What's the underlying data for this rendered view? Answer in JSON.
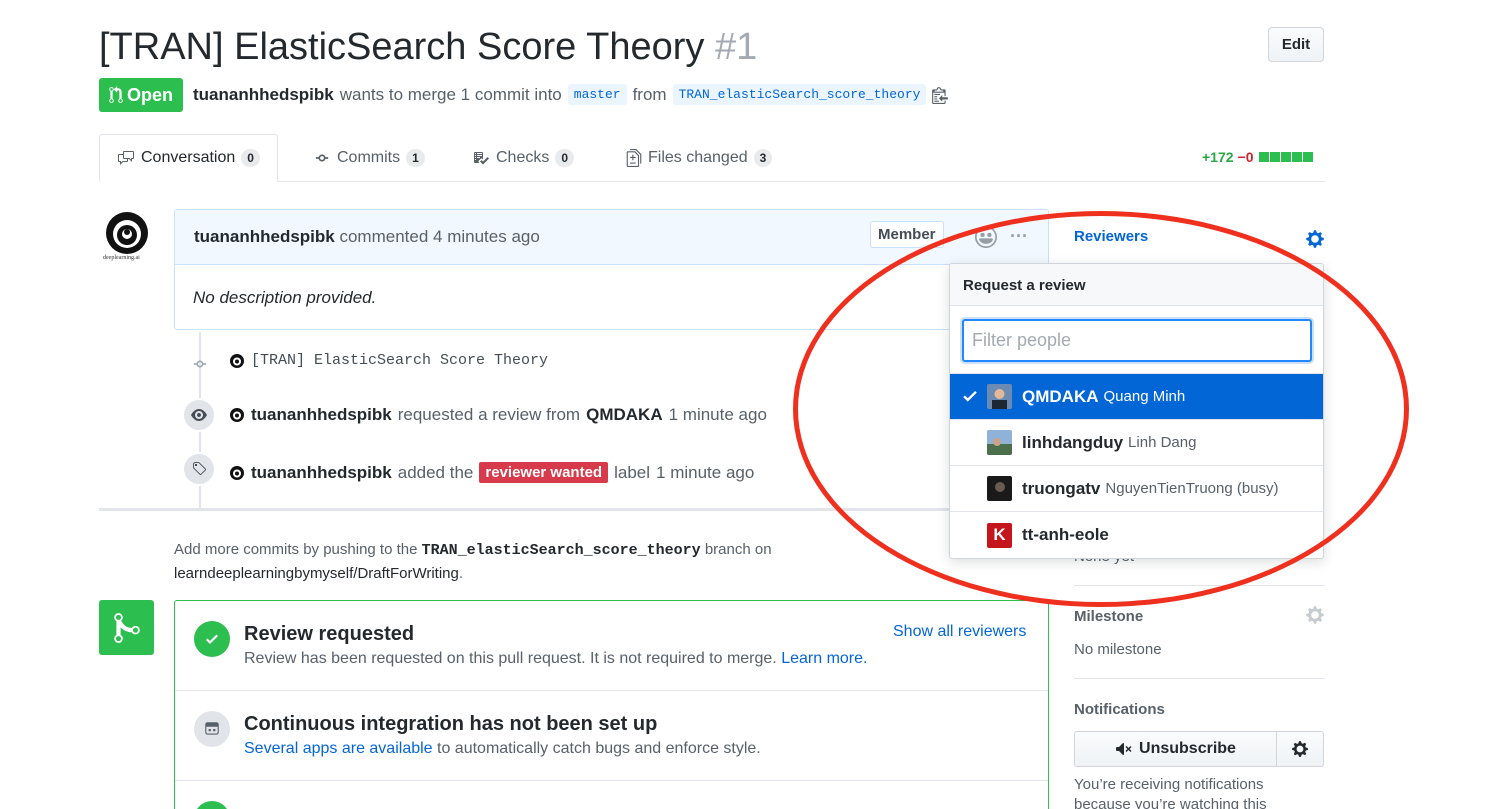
{
  "header": {
    "title": "[TRAN] ElasticSearch Score Theory",
    "number": "#1",
    "edit_label": "Edit",
    "status": "Open",
    "author": "tuananhhedspibk",
    "merge_text": "wants to merge 1 commit into",
    "base_branch": "master",
    "from_text": "from",
    "head_branch": "TRAN_elasticSearch_score_theory"
  },
  "tabs": [
    {
      "label": "Conversation",
      "count": "0"
    },
    {
      "label": "Commits",
      "count": "1"
    },
    {
      "label": "Checks",
      "count": "0"
    },
    {
      "label": "Files changed",
      "count": "3"
    }
  ],
  "diffstat": {
    "additions": "+172",
    "deletions": "−0"
  },
  "comment": {
    "author": "tuananhhedspibk",
    "action": "commented",
    "time": "4 minutes ago",
    "badge": "Member",
    "body": "No description provided.",
    "avatar_caption": "deeplearning.ai"
  },
  "timeline": {
    "commit_message": "[TRAN] ElasticSearch Score Theory",
    "review_actor": "tuananhhedspibk",
    "review_text": "requested a review from",
    "review_target": "QMDAKA",
    "review_time": "1 minute ago",
    "label_actor": "tuananhhedspibk",
    "label_text": "added the",
    "label_name": "reviewer wanted",
    "label_suffix": "label",
    "label_time": "1 minute ago"
  },
  "push_info": {
    "prefix": "Add more commits by pushing to the",
    "branch": "TRAN_elasticSearch_score_theory",
    "suffix": "branch on",
    "repo": "learndeeplearningbymyself/DraftForWriting",
    "period": "."
  },
  "merge_box": {
    "review_title": "Review requested",
    "review_sub": "Review has been requested on this pull request. It is not required to merge.",
    "learn_more": "Learn more.",
    "show_all": "Show all reviewers",
    "ci_title": "Continuous integration has not been set up",
    "ci_link": "Several apps are available",
    "ci_sub": "to automatically catch bugs and enforce style."
  },
  "sidebar": {
    "reviewers_label": "Reviewers",
    "labels_value": "None yet",
    "milestone_label": "Milestone",
    "milestone_value": "No milestone",
    "notifications_label": "Notifications",
    "unsubscribe_label": "Unsubscribe",
    "notif_text_1": "You’re receiving notifications",
    "notif_text_2": "because you’re watching this"
  },
  "review_popup": {
    "title": "Request a review",
    "filter_placeholder": "Filter people",
    "people": [
      {
        "login": "QMDAKA",
        "name": "Quang Minh",
        "selected": true
      },
      {
        "login": "linhdangduy",
        "name": "Linh Dang",
        "selected": false
      },
      {
        "login": "truongatv",
        "name": "NguyenTienTruong (busy)",
        "selected": false
      },
      {
        "login": "tt-anh-eole",
        "name": "",
        "selected": false,
        "avatar_letter": "K"
      }
    ]
  },
  "colors": {
    "open_green": "#2cbe4e",
    "link_blue": "#0366d6",
    "label_red": "#d73a4a",
    "annotation_red": "#f0301e"
  }
}
